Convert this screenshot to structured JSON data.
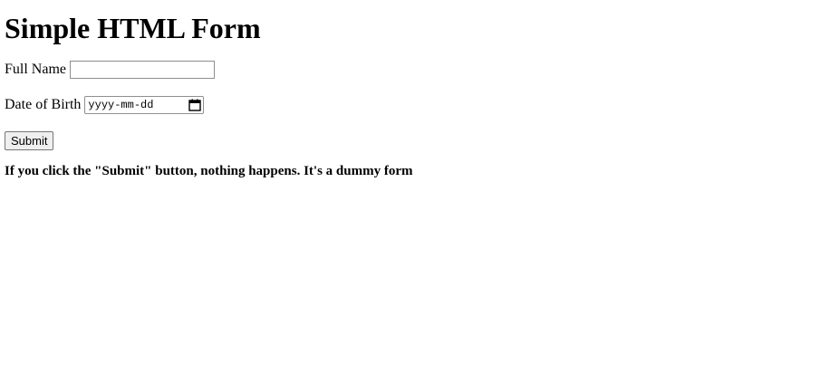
{
  "page": {
    "title": "Simple HTML Form"
  },
  "form": {
    "full_name_label": "Full Name",
    "full_name_value": "",
    "dob_label": "Date of Birth",
    "dob_placeholder": "yyyy-mm-dd",
    "submit_label": "Submit"
  },
  "note": {
    "text": "If you click the \"Submit\" button, nothing happens. It's a dummy form"
  },
  "icons": {
    "calendar": "calendar-icon"
  }
}
